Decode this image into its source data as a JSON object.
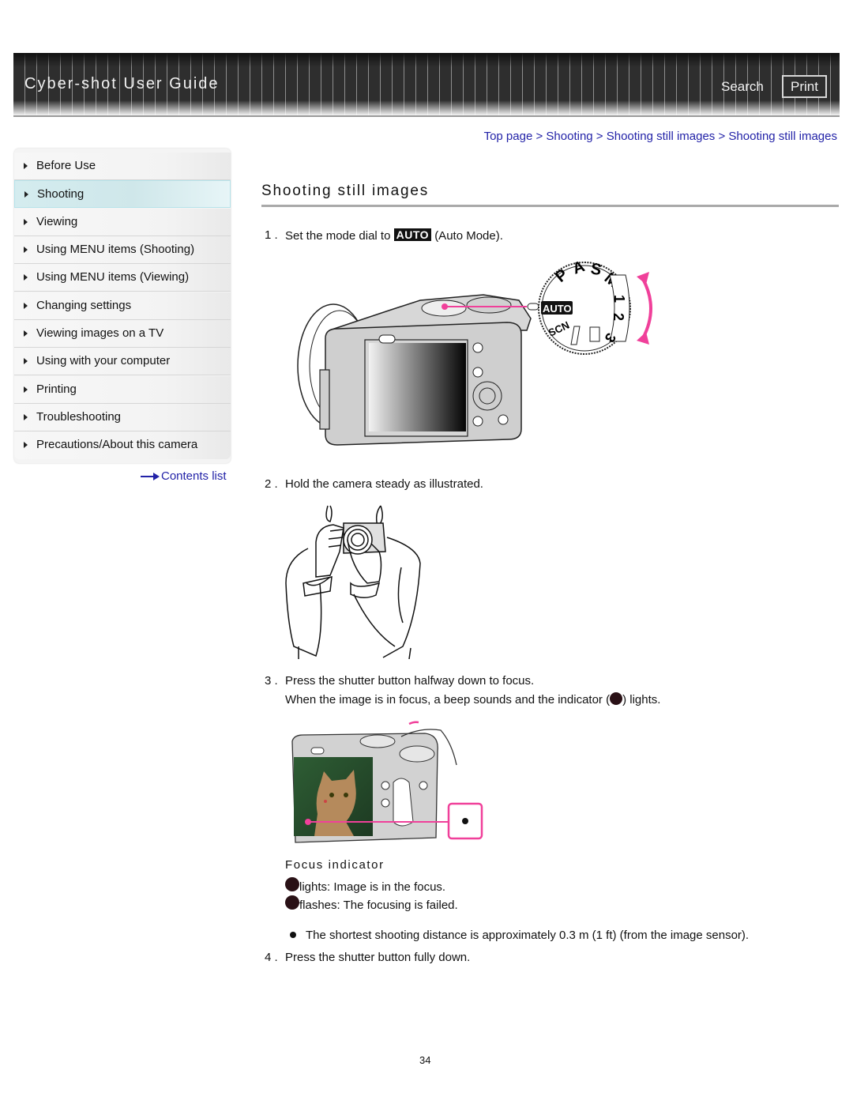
{
  "header": {
    "title": "Cyber-shot User Guide",
    "search_label": "Search",
    "print_label": "Print"
  },
  "sidebar": {
    "items": [
      {
        "label": "Before Use",
        "active": false
      },
      {
        "label": "Shooting",
        "active": true
      },
      {
        "label": "Viewing",
        "active": false
      },
      {
        "label": "Using MENU items (Shooting)",
        "active": false
      },
      {
        "label": "Using MENU items (Viewing)",
        "active": false
      },
      {
        "label": "Changing settings",
        "active": false
      },
      {
        "label": "Viewing images on a TV",
        "active": false
      },
      {
        "label": "Using with your computer",
        "active": false
      },
      {
        "label": "Printing",
        "active": false
      },
      {
        "label": "Troubleshooting",
        "active": false
      },
      {
        "label": "Precautions/About this camera",
        "active": false
      }
    ],
    "contents_link": "Contents list"
  },
  "breadcrumb": {
    "items": [
      "Top page",
      "Shooting",
      "Shooting still images",
      "Shooting still images"
    ],
    "separator": ">"
  },
  "page": {
    "title": "Shooting still images",
    "steps": [
      {
        "num": "1 .",
        "text_before": "Set the mode dial to",
        "badge": "AUTO",
        "text_after": "(Auto Mode)."
      },
      {
        "num": "2 .",
        "text": "Hold the camera steady as illustrated."
      },
      {
        "num": "3 .",
        "text": "Press the shutter button halfway down to focus.",
        "subtext_before": "When the image is in focus, a beep sounds and the indicator (",
        "subtext_after": ") lights."
      },
      {
        "num": "4 .",
        "text": "Press the shutter button fully down."
      }
    ],
    "dial_labels": [
      "P",
      "A",
      "S",
      "M",
      "1",
      "2",
      "3",
      "SCN",
      "AUTO"
    ],
    "focus_indicator": {
      "heading": "Focus indicator",
      "rows": [
        "lights: Image is in the focus.",
        "flashes: The focusing is failed."
      ]
    },
    "note": "The shortest shooting distance is approximately 0.3 m (1 ft) (from the image sensor).",
    "page_number": "34"
  },
  "colors": {
    "link": "#2323a8",
    "accent_pink": "#f0409a",
    "banner": "#2e2e2e",
    "active_item": "#d4ecef"
  }
}
